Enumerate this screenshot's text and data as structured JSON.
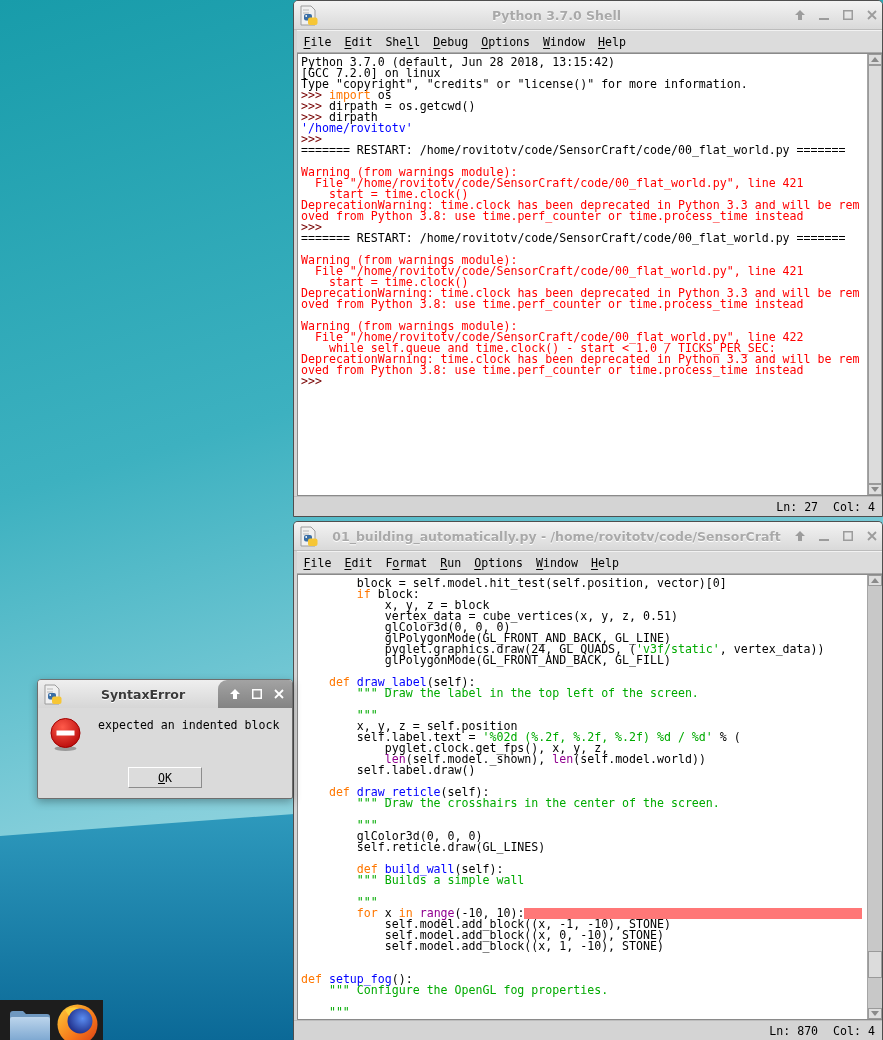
{
  "shell_window": {
    "title": "Python 3.7.0 Shell",
    "active": false,
    "menu": [
      {
        "mnemonic": "F",
        "rest": "ile"
      },
      {
        "mnemonic": "E",
        "rest": "dit"
      },
      {
        "lead": "She",
        "mnemonic": "l",
        "rest": "l"
      },
      {
        "mnemonic": "D",
        "rest": "ebug"
      },
      {
        "mnemonic": "O",
        "rest": "ptions"
      },
      {
        "mnemonic": "W",
        "rest": "indow"
      },
      {
        "mnemonic": "H",
        "rest": "elp"
      }
    ],
    "lines": [
      {
        "kind": "text",
        "tokens": [
          {
            "text": "Python 3.7.0 (default, Jun 28 2018, 13:15:42)",
            "kind": "plain"
          }
        ]
      },
      {
        "kind": "text",
        "tokens": [
          {
            "text": "[GCC 7.2.0] on linux",
            "kind": "plain"
          }
        ]
      },
      {
        "kind": "text",
        "tokens": [
          {
            "text": "Type \"copyright\", \"credits\" or \"license()\" for more information.",
            "kind": "plain"
          }
        ]
      },
      {
        "kind": "text",
        "tokens": [
          {
            "text": ">>> ",
            "kind": "prompt"
          },
          {
            "text": "import",
            "kind": "keyword"
          },
          {
            "text": " os",
            "kind": "plain"
          }
        ]
      },
      {
        "kind": "text",
        "tokens": [
          {
            "text": ">>> ",
            "kind": "prompt"
          },
          {
            "text": "dirpath = os.getcwd()",
            "kind": "plain"
          }
        ]
      },
      {
        "kind": "text",
        "tokens": [
          {
            "text": ">>> ",
            "kind": "prompt"
          },
          {
            "text": "dirpath",
            "kind": "plain"
          }
        ]
      },
      {
        "kind": "text",
        "tokens": [
          {
            "text": "'/home/rovitotv'",
            "kind": "stdout"
          }
        ]
      },
      {
        "kind": "text",
        "tokens": [
          {
            "text": ">>>",
            "kind": "prompt"
          }
        ]
      },
      {
        "kind": "text",
        "tokens": [
          {
            "text": "======= RESTART: /home/rovitotv/code/SensorCraft/code/00_flat_world.py =======",
            "kind": "plain"
          }
        ]
      },
      {
        "kind": "blank"
      },
      {
        "kind": "text",
        "tokens": [
          {
            "text": "Warning (from warnings module):",
            "kind": "stderr"
          }
        ]
      },
      {
        "kind": "text",
        "tokens": [
          {
            "text": "  File \"/home/rovitotv/code/SensorCraft/code/00_flat_world.py\", line 421",
            "kind": "stderr"
          }
        ]
      },
      {
        "kind": "text",
        "tokens": [
          {
            "text": "    start = time.clock()",
            "kind": "stderr"
          }
        ]
      },
      {
        "kind": "text",
        "tokens": [
          {
            "text": "DeprecationWarning: time.clock has been deprecated in Python 3.3 and will be rem",
            "kind": "stderr"
          }
        ]
      },
      {
        "kind": "text",
        "tokens": [
          {
            "text": "oved from Python 3.8: use time.perf_counter or time.process_time instead",
            "kind": "stderr"
          }
        ]
      },
      {
        "kind": "text",
        "tokens": [
          {
            "text": ">>>",
            "kind": "prompt"
          }
        ]
      },
      {
        "kind": "text",
        "tokens": [
          {
            "text": "======= RESTART: /home/rovitotv/code/SensorCraft/code/00_flat_world.py =======",
            "kind": "plain"
          }
        ]
      },
      {
        "kind": "blank"
      },
      {
        "kind": "text",
        "tokens": [
          {
            "text": "Warning (from warnings module):",
            "kind": "stderr"
          }
        ]
      },
      {
        "kind": "text",
        "tokens": [
          {
            "text": "  File \"/home/rovitotv/code/SensorCraft/code/00_flat_world.py\", line 421",
            "kind": "stderr"
          }
        ]
      },
      {
        "kind": "text",
        "tokens": [
          {
            "text": "    start = time.clock()",
            "kind": "stderr"
          }
        ]
      },
      {
        "kind": "text",
        "tokens": [
          {
            "text": "DeprecationWarning: time.clock has been deprecated in Python 3.3 and will be rem",
            "kind": "stderr"
          }
        ]
      },
      {
        "kind": "text",
        "tokens": [
          {
            "text": "oved from Python 3.8: use time.perf_counter or time.process_time instead",
            "kind": "stderr"
          }
        ]
      },
      {
        "kind": "blank"
      },
      {
        "kind": "text",
        "tokens": [
          {
            "text": "Warning (from warnings module):",
            "kind": "stderr"
          }
        ]
      },
      {
        "kind": "text",
        "tokens": [
          {
            "text": "  File \"/home/rovitotv/code/SensorCraft/code/00_flat_world.py\", line 422",
            "kind": "stderr"
          }
        ]
      },
      {
        "kind": "text",
        "tokens": [
          {
            "text": "    while self.queue and time.clock() - start < 1.0 / TICKS_PER_SEC:",
            "kind": "stderr"
          }
        ]
      },
      {
        "kind": "text",
        "tokens": [
          {
            "text": "DeprecationWarning: time.clock has been deprecated in Python 3.3 and will be rem",
            "kind": "stderr"
          }
        ]
      },
      {
        "kind": "text",
        "tokens": [
          {
            "text": "oved from Python 3.8: use time.perf_counter or time.process_time instead",
            "kind": "stderr"
          }
        ]
      },
      {
        "kind": "text",
        "tokens": [
          {
            "text": ">>>",
            "kind": "prompt"
          }
        ]
      }
    ],
    "status": {
      "line": "Ln: 27",
      "column": "Col: 4"
    }
  },
  "editor_window": {
    "title": "01_building_automatically.py - /home/rovitotv/code/SensorCraft",
    "active": false,
    "menu": [
      {
        "mnemonic": "F",
        "rest": "ile"
      },
      {
        "mnemonic": "E",
        "rest": "dit"
      },
      {
        "lead": "F",
        "mnemonic": "o",
        "rest": "rmat"
      },
      {
        "mnemonic": "R",
        "rest": "un"
      },
      {
        "mnemonic": "O",
        "rest": "ptions"
      },
      {
        "mnemonic": "W",
        "rest": "indow"
      },
      {
        "mnemonic": "H",
        "rest": "elp"
      }
    ],
    "lines": [
      {
        "kind": "text",
        "error": false,
        "tokens": [
          {
            "text": "        block = self.model.hit_test(self.position, vector)[0]",
            "kind": "plain"
          }
        ]
      },
      {
        "kind": "text",
        "error": false,
        "tokens": [
          {
            "text": "        if",
            "kind": "keyword"
          },
          {
            "text": " block:",
            "kind": "plain"
          }
        ]
      },
      {
        "kind": "text",
        "error": false,
        "tokens": [
          {
            "text": "            x, y, z = block",
            "kind": "plain"
          }
        ]
      },
      {
        "kind": "text",
        "error": false,
        "tokens": [
          {
            "text": "            vertex_data = cube_vertices(x, y, z, 0.51)",
            "kind": "plain"
          }
        ]
      },
      {
        "kind": "text",
        "error": false,
        "tokens": [
          {
            "text": "            glColor3d(0, 0, 0)",
            "kind": "plain"
          }
        ]
      },
      {
        "kind": "text",
        "error": false,
        "tokens": [
          {
            "text": "            glPolygonMode(GL_FRONT_AND_BACK, GL_LINE)",
            "kind": "plain"
          }
        ]
      },
      {
        "kind": "text",
        "error": false,
        "tokens": [
          {
            "text": "            pyglet.graphics.draw(24, GL_QUADS, (",
            "kind": "plain"
          },
          {
            "text": "'v3f/static'",
            "kind": "string"
          },
          {
            "text": ", vertex_data))",
            "kind": "plain"
          }
        ]
      },
      {
        "kind": "text",
        "error": false,
        "tokens": [
          {
            "text": "            glPolygonMode(GL_FRONT_AND_BACK, GL_FILL)",
            "kind": "plain"
          }
        ]
      },
      {
        "kind": "blank"
      },
      {
        "kind": "text",
        "error": false,
        "tokens": [
          {
            "text": "    def",
            "kind": "keyword"
          },
          {
            "text": " draw_label",
            "kind": "definition"
          },
          {
            "text": "(self):",
            "kind": "plain"
          }
        ]
      },
      {
        "kind": "text",
        "error": false,
        "tokens": [
          {
            "text": "        \"\"\" Draw the label in the top left of the screen.",
            "kind": "string"
          }
        ]
      },
      {
        "kind": "blank"
      },
      {
        "kind": "text",
        "error": false,
        "tokens": [
          {
            "text": "        \"\"\"",
            "kind": "string"
          }
        ]
      },
      {
        "kind": "text",
        "error": false,
        "tokens": [
          {
            "text": "        x, y, z = self.position",
            "kind": "plain"
          }
        ]
      },
      {
        "kind": "text",
        "error": false,
        "tokens": [
          {
            "text": "        self.label.text = ",
            "kind": "plain"
          },
          {
            "text": "'%02d (%.2f, %.2f, %.2f) %d / %d'",
            "kind": "string"
          },
          {
            "text": " % (",
            "kind": "plain"
          }
        ]
      },
      {
        "kind": "text",
        "error": false,
        "tokens": [
          {
            "text": "            pyglet.clock.get_fps(), x, y, z,",
            "kind": "plain"
          }
        ]
      },
      {
        "kind": "text",
        "error": false,
        "tokens": [
          {
            "text": "            len",
            "kind": "builtin"
          },
          {
            "text": "(self.model._shown), ",
            "kind": "plain"
          },
          {
            "text": "len",
            "kind": "builtin"
          },
          {
            "text": "(self.model.world))",
            "kind": "plain"
          }
        ]
      },
      {
        "kind": "text",
        "error": false,
        "tokens": [
          {
            "text": "        self.label.draw()",
            "kind": "plain"
          }
        ]
      },
      {
        "kind": "blank"
      },
      {
        "kind": "text",
        "error": false,
        "tokens": [
          {
            "text": "    def",
            "kind": "keyword"
          },
          {
            "text": " draw_reticle",
            "kind": "definition"
          },
          {
            "text": "(self):",
            "kind": "plain"
          }
        ]
      },
      {
        "kind": "text",
        "error": false,
        "tokens": [
          {
            "text": "        \"\"\" Draw the crosshairs in the center of the screen.",
            "kind": "string"
          }
        ]
      },
      {
        "kind": "blank"
      },
      {
        "kind": "text",
        "error": false,
        "tokens": [
          {
            "text": "        \"\"\"",
            "kind": "string"
          }
        ]
      },
      {
        "kind": "text",
        "error": false,
        "tokens": [
          {
            "text": "        glColor3d(0, 0, 0)",
            "kind": "plain"
          }
        ]
      },
      {
        "kind": "text",
        "error": false,
        "tokens": [
          {
            "text": "        self.reticle.draw(GL_LINES)",
            "kind": "plain"
          }
        ]
      },
      {
        "kind": "blank"
      },
      {
        "kind": "text",
        "error": false,
        "tokens": [
          {
            "text": "        def",
            "kind": "keyword"
          },
          {
            "text": " build_wall",
            "kind": "definition"
          },
          {
            "text": "(self):",
            "kind": "plain"
          }
        ]
      },
      {
        "kind": "text",
        "error": false,
        "tokens": [
          {
            "text": "        \"\"\" Builds a simple wall",
            "kind": "string"
          }
        ]
      },
      {
        "kind": "blank"
      },
      {
        "kind": "text",
        "error": false,
        "tokens": [
          {
            "text": "        \"\"\"",
            "kind": "string"
          }
        ]
      },
      {
        "kind": "text",
        "error": true,
        "tokens": [
          {
            "text": "        for",
            "kind": "keyword"
          },
          {
            "text": " x ",
            "kind": "plain"
          },
          {
            "text": "in",
            "kind": "keyword"
          },
          {
            "text": " range",
            "kind": "builtin"
          },
          {
            "text": "(-10, 10):",
            "kind": "plain"
          }
        ]
      },
      {
        "kind": "text",
        "error": false,
        "tokens": [
          {
            "text": "            self.model.add_block((x, -1, -10), STONE)",
            "kind": "plain"
          }
        ]
      },
      {
        "kind": "text",
        "error": false,
        "tokens": [
          {
            "text": "            self.model.add_block((x, 0, -10), STONE)",
            "kind": "plain"
          }
        ]
      },
      {
        "kind": "text",
        "error": false,
        "tokens": [
          {
            "text": "            self.model.add_block((x, 1, -10), STONE)",
            "kind": "plain"
          }
        ]
      },
      {
        "kind": "blank"
      },
      {
        "kind": "blank"
      },
      {
        "kind": "text",
        "error": false,
        "tokens": [
          {
            "text": "def",
            "kind": "keyword"
          },
          {
            "text": " setup_fog",
            "kind": "definition"
          },
          {
            "text": "():",
            "kind": "plain"
          }
        ]
      },
      {
        "kind": "text",
        "error": false,
        "tokens": [
          {
            "text": "    \"\"\" Configure the OpenGL fog properties.",
            "kind": "string"
          }
        ]
      },
      {
        "kind": "blank"
      },
      {
        "kind": "text",
        "error": false,
        "tokens": [
          {
            "text": "    \"\"\"",
            "kind": "string"
          }
        ]
      }
    ],
    "status": {
      "line": "Ln: 870",
      "column": "Col: 4"
    }
  },
  "dialog": {
    "title": "SyntaxError",
    "active": true,
    "message": "expected an indented block",
    "button": {
      "mnemonic": "O",
      "rest": "K"
    }
  }
}
